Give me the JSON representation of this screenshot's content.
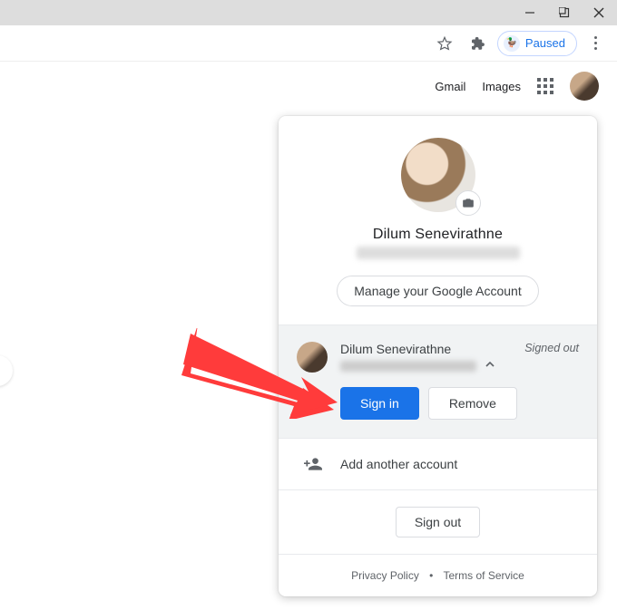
{
  "window": {
    "paused_label": "Paused"
  },
  "gnav": {
    "gmail": "Gmail",
    "images": "Images"
  },
  "account_card": {
    "name": "Dilum Senevirathne",
    "manage_label": "Manage your Google Account",
    "expanded_account": {
      "name": "Dilum Senevirathne",
      "status": "Signed out",
      "sign_in_label": "Sign in",
      "remove_label": "Remove"
    },
    "add_label": "Add another account",
    "sign_out_label": "Sign out",
    "privacy_label": "Privacy Policy",
    "terms_label": "Terms of Service"
  }
}
